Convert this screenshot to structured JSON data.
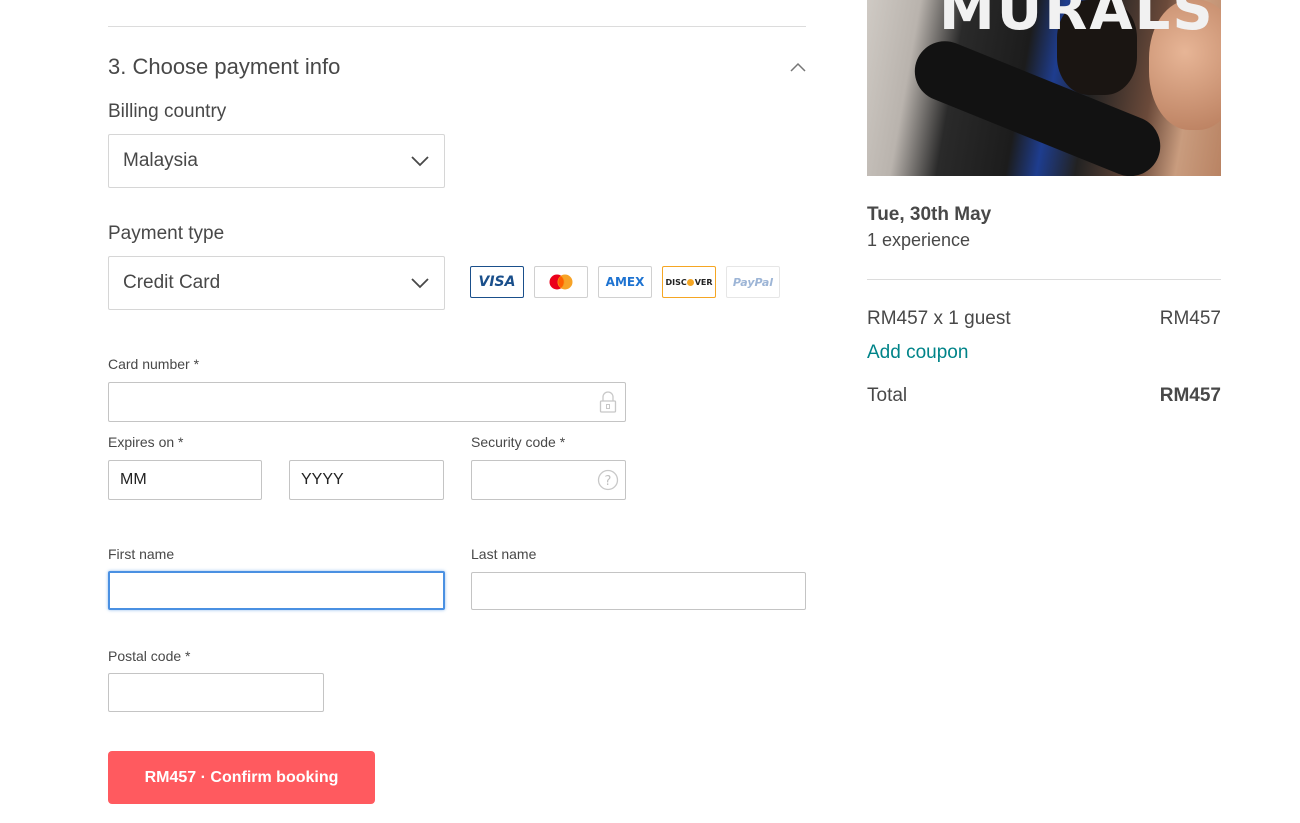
{
  "section": {
    "title": "3. Choose payment info"
  },
  "billing": {
    "label": "Billing country",
    "selected": "Malaysia"
  },
  "payment": {
    "label": "Payment type",
    "selected": "Credit Card",
    "card_logos": [
      {
        "name": "visa",
        "label": "VISA"
      },
      {
        "name": "mastercard",
        "label": ""
      },
      {
        "name": "amex",
        "label": "AMEX"
      },
      {
        "name": "discover",
        "label_left": "DISC",
        "label_right": "VER"
      },
      {
        "name": "paypal",
        "label": "PayPal"
      }
    ]
  },
  "card": {
    "number_label": "Card number  *",
    "expires_label": "Expires on  *",
    "month_placeholder": "MM",
    "year_placeholder": "YYYY",
    "security_label": "Security code  *"
  },
  "name": {
    "first_label": "First name",
    "last_label": "Last name"
  },
  "postal": {
    "label": "Postal code *"
  },
  "confirm_button": "RM457 · Confirm booking",
  "summary": {
    "image_text": "MURALS",
    "date": "Tue, 30th May",
    "experience_count": "1 experience",
    "price_line_label": "RM457 x 1 guest",
    "price_line_value": "RM457",
    "coupon_link": "Add coupon",
    "total_label": "Total",
    "total_value": "RM457"
  },
  "colors": {
    "accent": "#ff5a5f",
    "link": "#008489",
    "focus": "#4a90e2"
  }
}
